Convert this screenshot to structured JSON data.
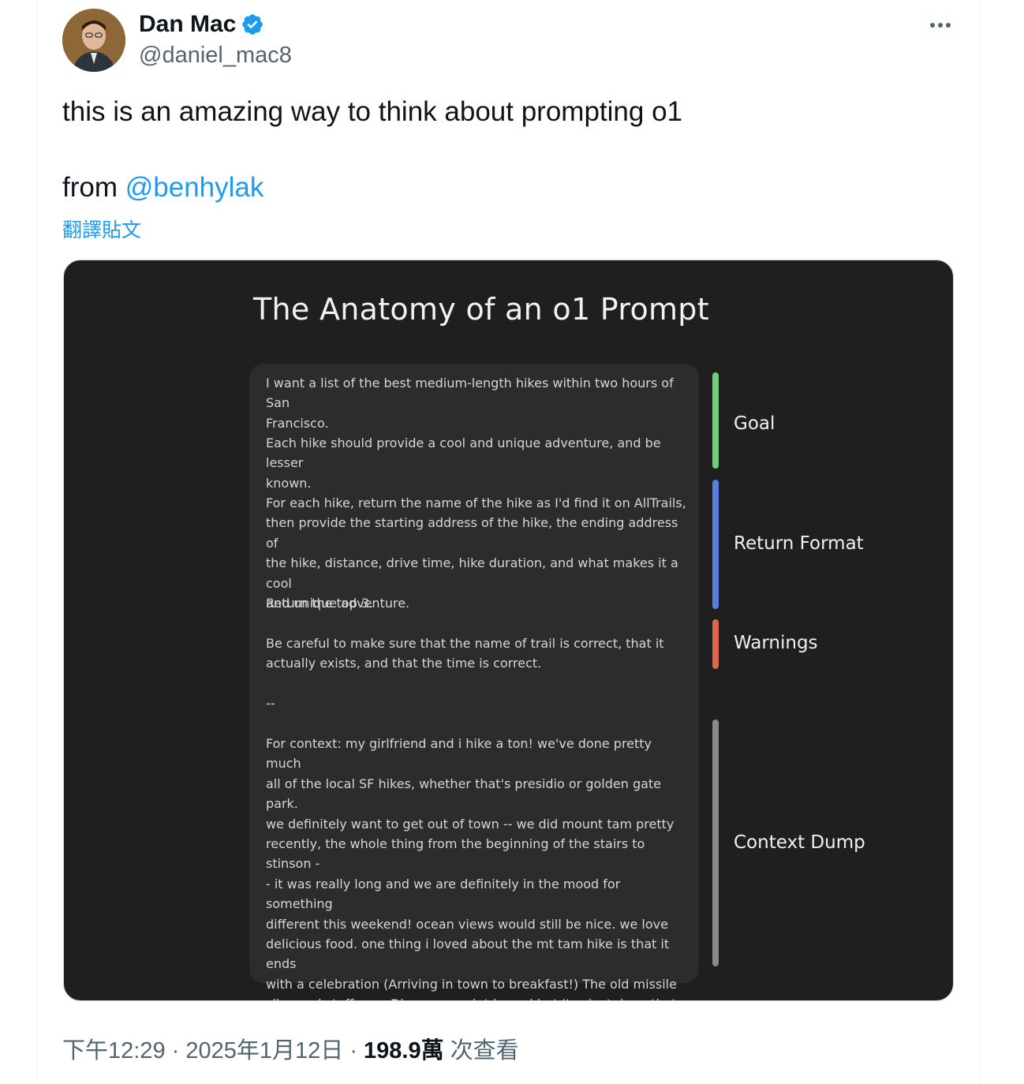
{
  "author": {
    "name": "Dan Mac",
    "handle": "@daniel_mac8"
  },
  "tweet": {
    "line1": "this is an amazing way to think about prompting o1",
    "from_label": "from ",
    "mention": "@benhylak",
    "translate_label": "翻譯貼文"
  },
  "image": {
    "title": "The Anatomy of an o1 Prompt",
    "paragraphs": [
      "I want a list of the best medium-length hikes within two hours of San\nFrancisco.",
      "Each hike should provide a cool and unique adventure, and be lesser\nknown.",
      "For each hike, return the name of the hike as I'd find it on AllTrails,\nthen provide the starting address of the hike, the ending address of\nthe hike, distance, drive time, hike duration, and what makes it a cool\nand unique adventure.",
      "Return the top 3.",
      "Be careful to make sure that the name of trail is correct, that it\nactually exists, and that the time is correct.",
      "--",
      "For context: my girlfriend and i hike a ton! we've done pretty much\nall of the local SF hikes, whether that's presidio or golden gate park.\nwe definitely want to get out of town -- we did mount tam pretty\nrecently, the whole thing from the beginning of the stairs to stinson -\n- it was really long and we are definitely in the mood for something\ndifferent this weekend! ocean views would still be nice. we love\ndelicious food. one thing i loved about the mt tam hike is that it ends\nwith a celebration (Arriving in town to breakfast!) The old missile\nsilos and stuff near Discovery point is cool but I've just done that\nhike probably 20x at this point. We won't be seeing eachother for a\nfew weeks (she has to stay in LA for work) so the uniqueness here\nreally counts."
    ],
    "sections": [
      {
        "label": "Goal",
        "color": "#6fcf7c"
      },
      {
        "label": "Return Format",
        "color": "#5b7fe0"
      },
      {
        "label": "Warnings",
        "color": "#e0664a"
      },
      {
        "label": "Context Dump",
        "color": "#8a8a8a"
      }
    ]
  },
  "footer": {
    "time": "下午12:29",
    "sep1": " · ",
    "date": "2025年1月12日",
    "sep2": " · ",
    "views": "198.9萬",
    "views_label": " 次查看"
  },
  "colors": {
    "accent": "#1d9bf0",
    "verified": "#1d9bf0"
  }
}
